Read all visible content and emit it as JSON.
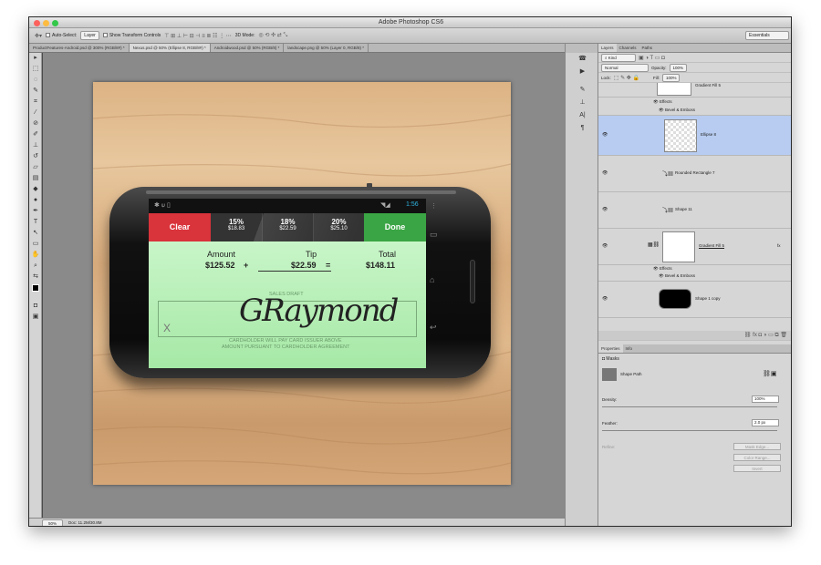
{
  "app": {
    "title": "Adobe Photoshop CS6"
  },
  "options": {
    "tool_icon": "move-tool-icon",
    "auto_select_label": "Auto-Select:",
    "auto_select_value": "Layer",
    "transform_label": "Show Transform Controls",
    "mode3d_label": "3D Mode:",
    "workspace": "Essentials"
  },
  "tabs": [
    {
      "label": "ProductFeatures-Android.psd @ 300% (RGB/8#) *"
    },
    {
      "label": "Nexus.psd @ 50% (Ellipse 8, RGB/8#) *"
    },
    {
      "label": "Androidwood.psd @ 50% (RGB/8) *"
    },
    {
      "label": "landscape.png @ 50% (Layer 0, RGB/8) *"
    }
  ],
  "status": {
    "zoom": "50%",
    "doc": "Doc: 11.2M/30.8M"
  },
  "phone": {
    "time": "1:56",
    "clear": "Clear",
    "tips": [
      {
        "pct": "15%",
        "amt": "$18.83"
      },
      {
        "pct": "18%",
        "amt": "$22.59"
      },
      {
        "pct": "20%",
        "amt": "$25.10"
      }
    ],
    "done": "Done",
    "amount_label": "Amount",
    "amount": "$125.52",
    "plus": "+",
    "tip_label": "Tip",
    "tip": "$22.59",
    "equals": "=",
    "total_label": "Total",
    "total": "$148.11",
    "sales_draft": "SALES DRAFT",
    "x_mark": "X",
    "signature": "GRaymond",
    "agreement1": "CARDHOLDER WILL PAY CARD ISSUER ABOVE",
    "agreement2": "AMOUNT PURSUANT TO CARDHOLDER AGREEMENT"
  },
  "layers_panel": {
    "tabs": [
      "Layers",
      "Channels",
      "Paths"
    ],
    "kind": "Kind",
    "blend": "Normal",
    "opacity_label": "Opacity:",
    "opacity": "100%",
    "lock_label": "Lock:",
    "fill_label": "Fill:",
    "fill": "100%",
    "items": [
      {
        "name": "Gradient Fill 5"
      },
      {
        "effects": "Effects",
        "bevel": "Bevel & Emboss"
      },
      {
        "name": "Ellipse 8"
      },
      {
        "name": "Rounded Rectangle 7"
      },
      {
        "name": "Shape 11"
      },
      {
        "name": "Gradient Fill 5"
      },
      {
        "effects": "Effects",
        "bevel": "Bevel & Emboss"
      },
      {
        "name": "Shape 1 copy"
      }
    ],
    "fx": "fx"
  },
  "properties": {
    "tabs": [
      "Properties",
      "Info"
    ],
    "section": "Masks",
    "shape_path": "Shape Path",
    "density_label": "Density:",
    "density": "100%",
    "feather_label": "Feather:",
    "feather": "2.0 px",
    "refine_label": "Refine:",
    "mask_edge": "Mask Edge...",
    "color_range": "Color Range...",
    "invert": "Invert"
  }
}
